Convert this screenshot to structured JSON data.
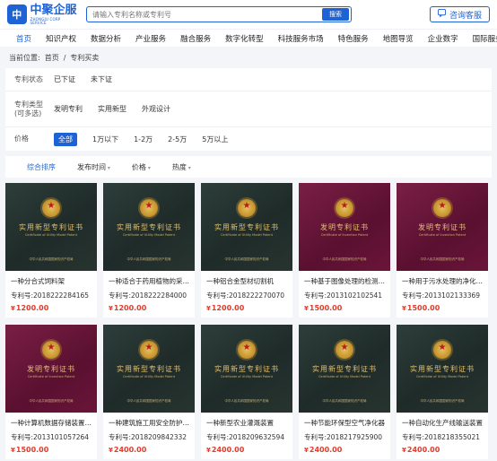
{
  "header": {
    "logo_mark": "中",
    "logo_cn": "中聚企服",
    "logo_en": "ZHONGJU CORP SERVICE",
    "search_placeholder": "请输入专利名称或专利号",
    "search_button": "搜索",
    "consult_label": "咨询客服"
  },
  "nav": {
    "items": [
      {
        "label": "首页"
      },
      {
        "label": "知识产权"
      },
      {
        "label": "数据分析"
      },
      {
        "label": "产业服务"
      },
      {
        "label": "融合服务"
      },
      {
        "label": "数字化转型"
      },
      {
        "label": "科技服务市场"
      },
      {
        "label": "特色服务"
      },
      {
        "label": "地图导览"
      },
      {
        "label": "企业数字"
      },
      {
        "label": "国际服务"
      }
    ]
  },
  "breadcrumb": {
    "prefix": "当前位置:",
    "home": "首页",
    "sep": "/",
    "current": "专利买卖"
  },
  "filters": {
    "status": {
      "label": "专利状态",
      "options": [
        "已下证",
        "未下证"
      ]
    },
    "type": {
      "label": "专利类型\n(可多选)",
      "options": [
        "发明专利",
        "实用新型",
        "外观设计"
      ]
    },
    "price": {
      "label": "价格",
      "options": [
        "全部",
        "1万以下",
        "1-2万",
        "2-5万",
        "5万以上"
      ],
      "selected_index": 0
    }
  },
  "sort": {
    "items": [
      "综合排序",
      "发布时间",
      "价格",
      "热度"
    ],
    "active_index": 0
  },
  "cert_text": {
    "utility_title": "实用新型专利证书",
    "utility_sub": "Certificate of Utility Model Patent",
    "invention_title": "发明专利证书",
    "invention_sub": "Certificate of Invention Patent",
    "foot": "中华人民共和国国家知识产权局"
  },
  "colors": {
    "accent": "#1e63d6",
    "price": "#e03b2c"
  },
  "products": [
    {
      "title": "一种分合式饲料架",
      "no_label": "专利号:",
      "no": "2018222284165",
      "price": "1200.00",
      "cert": "utility"
    },
    {
      "title": "一种适合于药用植物的采收装置",
      "no_label": "专利号:",
      "no": "2018222284000",
      "price": "1200.00",
      "cert": "utility"
    },
    {
      "title": "一种铝合金型材切割机",
      "no_label": "专利号:",
      "no": "2018222270070",
      "price": "1200.00",
      "cert": "utility"
    },
    {
      "title": "一种基于图像处理的检测方法",
      "no_label": "专利号:",
      "no": "2013102102541",
      "price": "1500.00",
      "cert": "invention"
    },
    {
      "title": "一种用于污水处理的净化系统",
      "no_label": "专利号:",
      "no": "2013102133369",
      "price": "1500.00",
      "cert": "invention"
    },
    {
      "title": "一种计算机数据存储装置及方法",
      "no_label": "专利号:",
      "no": "2013101057264",
      "price": "1500.00",
      "cert": "invention"
    },
    {
      "title": "一种建筑施工用安全防护装置",
      "no_label": "专利号:",
      "no": "2018209842332",
      "price": "2400.00",
      "cert": "utility"
    },
    {
      "title": "一种新型农业灌溉装置",
      "no_label": "专利号:",
      "no": "2018209632594",
      "price": "2400.00",
      "cert": "utility"
    },
    {
      "title": "一种节能环保型空气净化器",
      "no_label": "专利号:",
      "no": "2018217925900",
      "price": "2400.00",
      "cert": "utility"
    },
    {
      "title": "一种自动化生产线输送装置",
      "no_label": "专利号:",
      "no": "2018218355021",
      "price": "2400.00",
      "cert": "utility"
    }
  ]
}
